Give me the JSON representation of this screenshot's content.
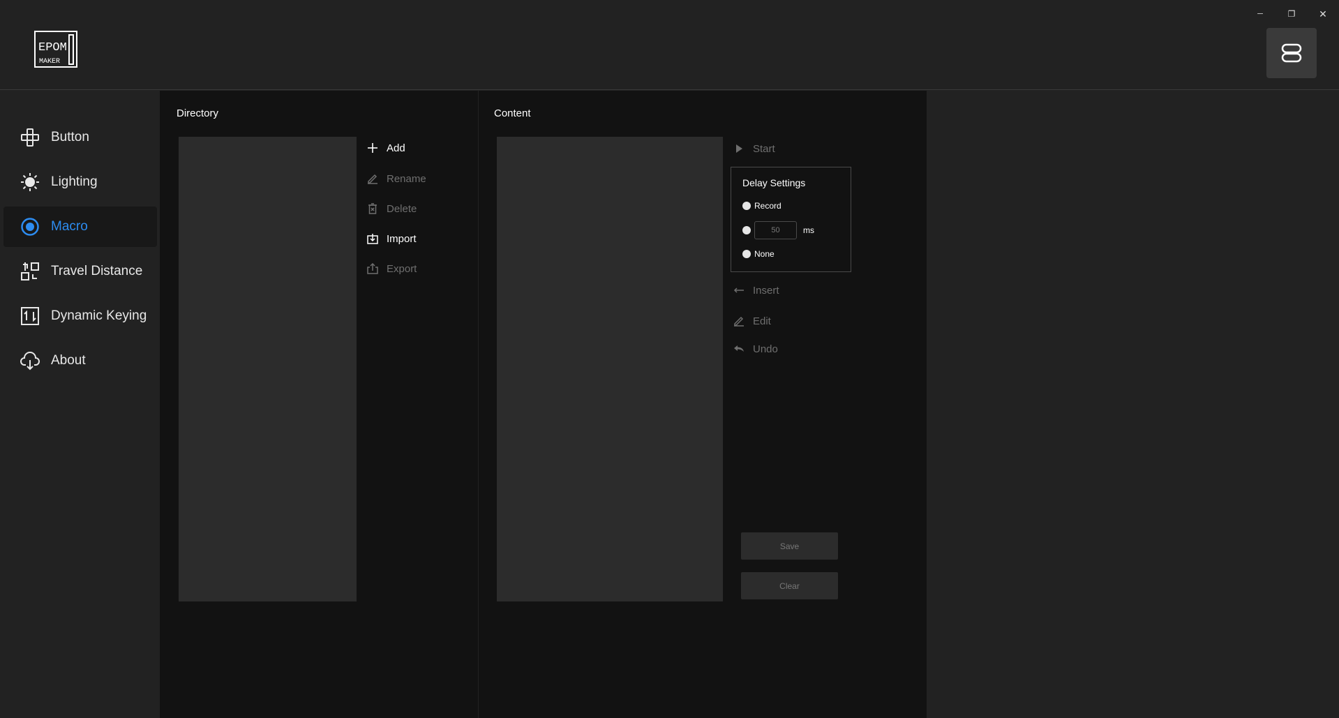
{
  "window": {
    "minimize_glyph": "─",
    "restore_glyph": "❐",
    "close_glyph": "✕"
  },
  "logo": {
    "line1": "EPOM",
    "line2": "MAKER"
  },
  "sidebar": {
    "items": [
      {
        "label": "Button",
        "icon": "gamepad-icon"
      },
      {
        "label": "Lighting",
        "icon": "sun-icon"
      },
      {
        "label": "Macro",
        "icon": "record-icon",
        "active": true
      },
      {
        "label": "Travel Distance",
        "icon": "travel-distance-icon"
      },
      {
        "label": "Dynamic Keying",
        "icon": "dynamic-keying-icon"
      },
      {
        "label": "About",
        "icon": "cloud-download-icon"
      }
    ]
  },
  "directory": {
    "title": "Directory",
    "actions": {
      "add": "Add",
      "rename": "Rename",
      "delete": "Delete",
      "import": "Import",
      "export": "Export"
    }
  },
  "content": {
    "title": "Content",
    "start": "Start",
    "delay": {
      "title": "Delay Settings",
      "record": "Record",
      "ms_value": "50",
      "ms_unit": "ms",
      "none": "None"
    },
    "insert": "Insert",
    "edit": "Edit",
    "undo": "Undo",
    "save": "Save",
    "clear": "Clear"
  },
  "colors": {
    "accent": "#2d8cf0",
    "background": "#222222",
    "panel": "#121212",
    "list": "#2c2c2c"
  }
}
